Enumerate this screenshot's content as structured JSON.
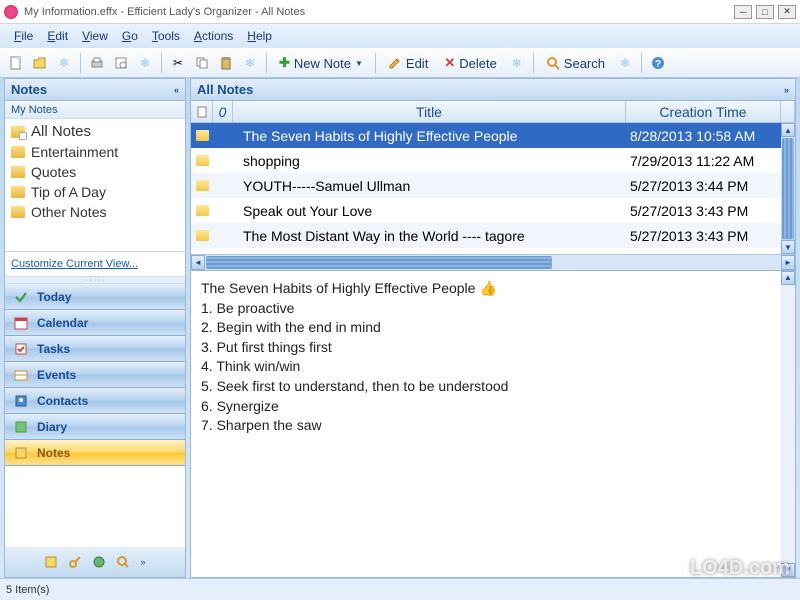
{
  "window": {
    "title": "My Information.effx - Efficient Lady's Organizer - All Notes"
  },
  "menubar": [
    {
      "label": "File",
      "u": "F"
    },
    {
      "label": "Edit",
      "u": "E"
    },
    {
      "label": "View",
      "u": "V"
    },
    {
      "label": "Go",
      "u": "G"
    },
    {
      "label": "Tools",
      "u": "T"
    },
    {
      "label": "Actions",
      "u": "A"
    },
    {
      "label": "Help",
      "u": "H"
    }
  ],
  "toolbar": {
    "new_note": "New Note",
    "edit": "Edit",
    "delete": "Delete",
    "search": "Search"
  },
  "sidebar": {
    "header": "Notes",
    "sub": "My Notes",
    "folders": [
      {
        "label": "All Notes",
        "selected": true
      },
      {
        "label": "Entertainment"
      },
      {
        "label": "Quotes"
      },
      {
        "label": "Tip of A Day"
      },
      {
        "label": "Other Notes"
      }
    ],
    "customize": "Customize Current View...",
    "nav": [
      {
        "label": "Today",
        "icon": "check"
      },
      {
        "label": "Calendar",
        "icon": "calendar"
      },
      {
        "label": "Tasks",
        "icon": "tasks"
      },
      {
        "label": "Events",
        "icon": "events"
      },
      {
        "label": "Contacts",
        "icon": "contacts"
      },
      {
        "label": "Diary",
        "icon": "diary"
      },
      {
        "label": "Notes",
        "icon": "notes",
        "active": true
      }
    ]
  },
  "content": {
    "header": "All Notes",
    "columns": {
      "title": "Title",
      "time": "Creation Time"
    },
    "rows": [
      {
        "title": "The Seven Habits of Highly Effective People",
        "time": "8/28/2013 10:58 AM",
        "selected": true
      },
      {
        "title": "shopping",
        "time": "7/29/2013 11:22 AM"
      },
      {
        "title": "YOUTH-----Samuel Ullman",
        "time": "5/27/2013 3:44 PM"
      },
      {
        "title": "Speak out Your Love",
        "time": "5/27/2013 3:43 PM"
      },
      {
        "title": "The Most Distant Way in the World  ---- tagore",
        "time": "5/27/2013 3:43 PM"
      }
    ]
  },
  "preview": {
    "title": "The Seven Habits of Highly Effective People",
    "lines": [
      "1. Be proactive",
      "2. Begin with the end in mind",
      "3. Put first things first",
      "4. Think win/win",
      "5. Seek first to understand, then to be understood",
      "6. Synergize",
      "7. Sharpen the saw"
    ]
  },
  "status": "5 Item(s)",
  "watermark": "LO4D.com"
}
